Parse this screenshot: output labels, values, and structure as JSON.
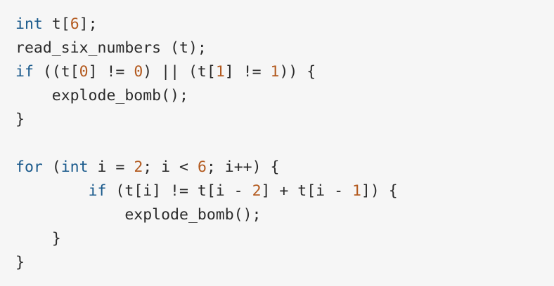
{
  "colors": {
    "background": "#f6f6f6",
    "text": "#2b2b2b",
    "keyword": "#1a5a8c",
    "number": "#b35a1f"
  },
  "code_lines": [
    [
      {
        "t": "int",
        "c": "kw"
      },
      {
        "t": " t["
      },
      {
        "t": "6",
        "c": "num"
      },
      {
        "t": "];"
      }
    ],
    [
      {
        "t": "read_six_numbers (t);"
      }
    ],
    [
      {
        "t": "if",
        "c": "kw"
      },
      {
        "t": " ((t["
      },
      {
        "t": "0",
        "c": "num"
      },
      {
        "t": "] != "
      },
      {
        "t": "0",
        "c": "num"
      },
      {
        "t": ") || (t["
      },
      {
        "t": "1",
        "c": "num"
      },
      {
        "t": "] != "
      },
      {
        "t": "1",
        "c": "num"
      },
      {
        "t": ")) {"
      }
    ],
    [
      {
        "t": "    explode_bomb();"
      }
    ],
    [
      {
        "t": "}"
      }
    ],
    [
      {
        "t": ""
      }
    ],
    [
      {
        "t": "for",
        "c": "kw"
      },
      {
        "t": " ("
      },
      {
        "t": "int",
        "c": "kw"
      },
      {
        "t": " i = "
      },
      {
        "t": "2",
        "c": "num"
      },
      {
        "t": "; i < "
      },
      {
        "t": "6",
        "c": "num"
      },
      {
        "t": "; i++) {"
      }
    ],
    [
      {
        "t": "        "
      },
      {
        "t": "if",
        "c": "kw"
      },
      {
        "t": " (t[i] != t[i - "
      },
      {
        "t": "2",
        "c": "num"
      },
      {
        "t": "] + t[i - "
      },
      {
        "t": "1",
        "c": "num"
      },
      {
        "t": "]) {"
      }
    ],
    [
      {
        "t": "            explode_bomb();"
      }
    ],
    [
      {
        "t": "    }"
      }
    ],
    [
      {
        "t": "}"
      }
    ]
  ]
}
